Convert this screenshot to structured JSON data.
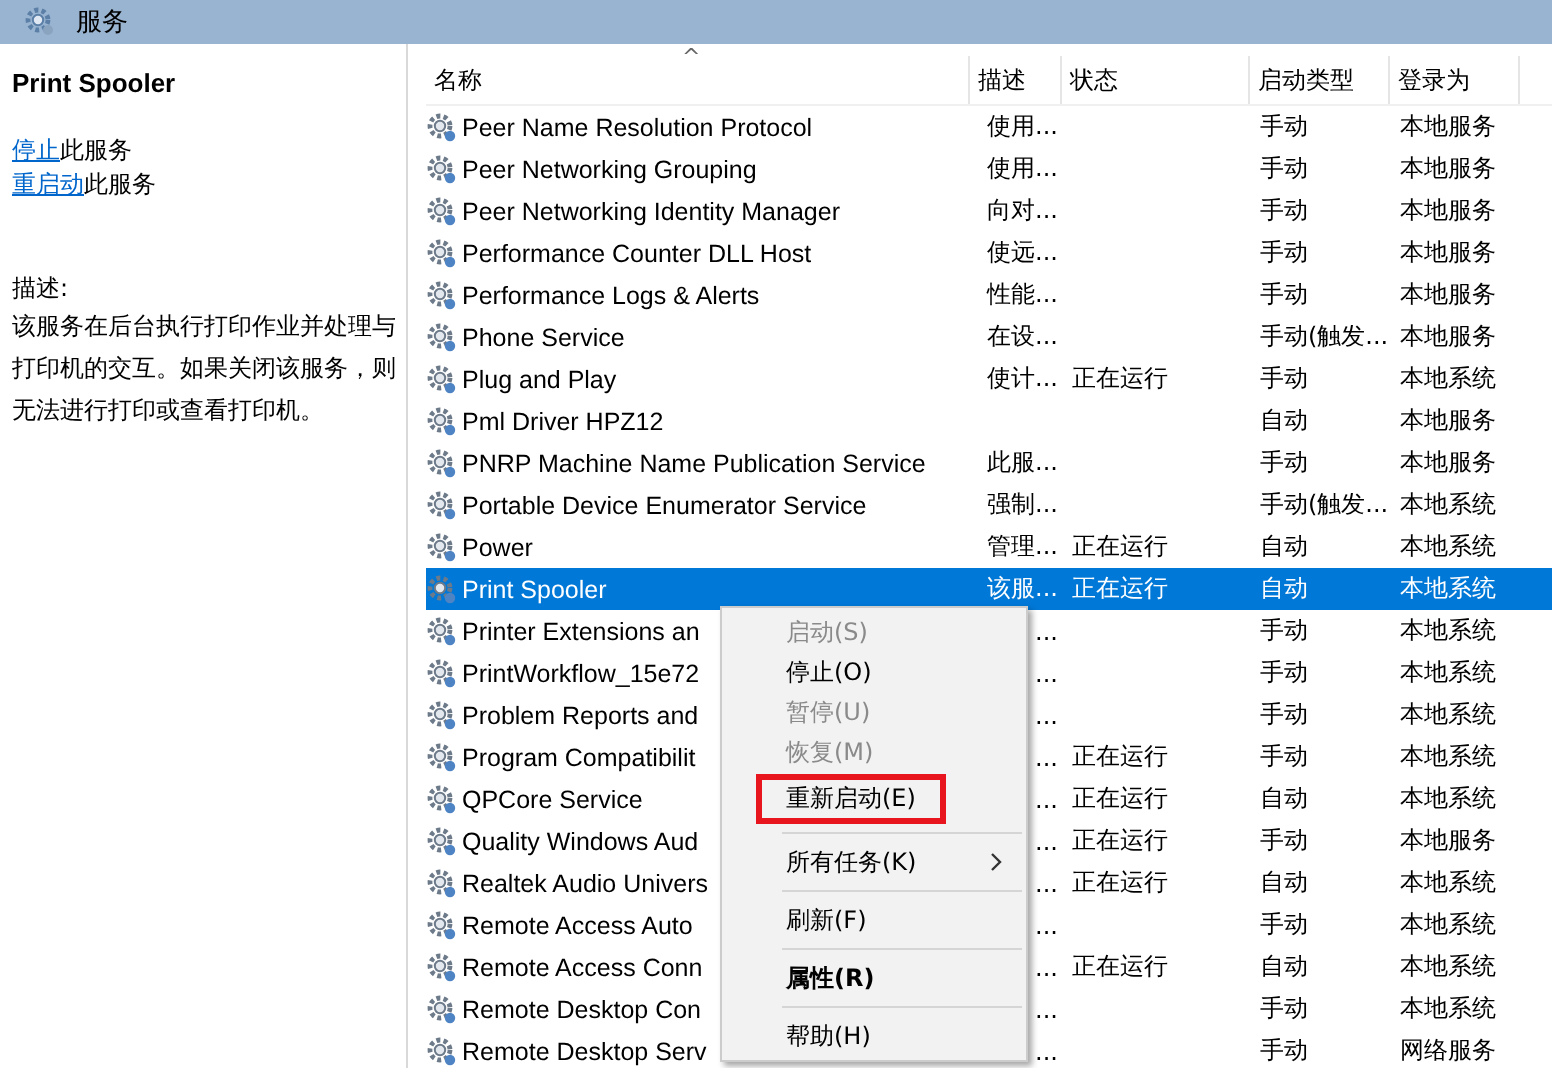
{
  "window": {
    "title": "服务"
  },
  "detail": {
    "service_name": "Print Spooler",
    "actions": [
      {
        "link": "停止",
        "rest": "此服务"
      },
      {
        "link": "重启动",
        "rest": "此服务"
      }
    ],
    "description_label": "描述:",
    "description": "该服务在后台执行打印作业并处理与打印机的交互。如果关闭该服务，则无法进行打印或查看打印机。"
  },
  "table": {
    "sort_indicator": "^",
    "columns": [
      "名称",
      "描述",
      "状态",
      "启动类型",
      "登录为"
    ],
    "rows": [
      {
        "name": "Peer Name Resolution Protocol",
        "description": "使用...",
        "status": "",
        "startup": "手动",
        "logon": "本地服务",
        "selected": false
      },
      {
        "name": "Peer Networking Grouping",
        "description": "使用...",
        "status": "",
        "startup": "手动",
        "logon": "本地服务",
        "selected": false
      },
      {
        "name": "Peer Networking Identity Manager",
        "description": "向对...",
        "status": "",
        "startup": "手动",
        "logon": "本地服务",
        "selected": false
      },
      {
        "name": "Performance Counter DLL Host",
        "description": "使远...",
        "status": "",
        "startup": "手动",
        "logon": "本地服务",
        "selected": false
      },
      {
        "name": "Performance Logs & Alerts",
        "description": "性能...",
        "status": "",
        "startup": "手动",
        "logon": "本地服务",
        "selected": false
      },
      {
        "name": "Phone Service",
        "description": "在设...",
        "status": "",
        "startup": "手动(触发...",
        "logon": "本地服务",
        "selected": false
      },
      {
        "name": "Plug and Play",
        "description": "使计...",
        "status": "正在运行",
        "startup": "手动",
        "logon": "本地系统",
        "selected": false
      },
      {
        "name": "Pml Driver HPZ12",
        "description": "",
        "status": "",
        "startup": "自动",
        "logon": "本地服务",
        "selected": false
      },
      {
        "name": "PNRP Machine Name Publication Service",
        "description": "此服...",
        "status": "",
        "startup": "手动",
        "logon": "本地服务",
        "selected": false
      },
      {
        "name": "Portable Device Enumerator Service",
        "description": "强制...",
        "status": "",
        "startup": "手动(触发...",
        "logon": "本地系统",
        "selected": false
      },
      {
        "name": "Power",
        "description": "管理...",
        "status": "正在运行",
        "startup": "自动",
        "logon": "本地系统",
        "selected": false
      },
      {
        "name": "Print Spooler",
        "description": "该服...",
        "status": "正在运行",
        "startup": "自动",
        "logon": "本地系统",
        "selected": true
      },
      {
        "name": "Printer Extensions an",
        "description": "...",
        "status": "",
        "startup": "手动",
        "logon": "本地系统",
        "selected": false
      },
      {
        "name": "PrintWorkflow_15e72",
        "description": "...",
        "status": "",
        "startup": "手动",
        "logon": "本地系统",
        "selected": false
      },
      {
        "name": "Problem Reports and",
        "description": "...",
        "status": "",
        "startup": "手动",
        "logon": "本地系统",
        "selected": false
      },
      {
        "name": "Program Compatibilit",
        "description": "...",
        "status": "正在运行",
        "startup": "手动",
        "logon": "本地系统",
        "selected": false
      },
      {
        "name": "QPCore Service",
        "description": "...",
        "status": "正在运行",
        "startup": "自动",
        "logon": "本地系统",
        "selected": false
      },
      {
        "name": "Quality Windows Aud",
        "description": "...",
        "status": "正在运行",
        "startup": "手动",
        "logon": "本地服务",
        "selected": false
      },
      {
        "name": "Realtek Audio Univers",
        "description": "...",
        "status": "正在运行",
        "startup": "自动",
        "logon": "本地系统",
        "selected": false
      },
      {
        "name": "Remote Access Auto",
        "description": "...",
        "status": "",
        "startup": "手动",
        "logon": "本地系统",
        "selected": false
      },
      {
        "name": "Remote Access Conn",
        "description": "...",
        "status": "正在运行",
        "startup": "自动",
        "logon": "本地系统",
        "selected": false
      },
      {
        "name": "Remote Desktop Con",
        "description": "...",
        "status": "",
        "startup": "手动",
        "logon": "本地系统",
        "selected": false
      },
      {
        "name": "Remote Desktop Serv",
        "description": "...",
        "status": "",
        "startup": "手动",
        "logon": "网络服务",
        "selected": false
      }
    ]
  },
  "context_menu": {
    "items": [
      {
        "kind": "item",
        "label": "启动(S)",
        "disabled": true,
        "highlighted": false,
        "bold": false,
        "submenu": false
      },
      {
        "kind": "item",
        "label": "停止(O)",
        "disabled": false,
        "highlighted": false,
        "bold": false,
        "submenu": false
      },
      {
        "kind": "item",
        "label": "暂停(U)",
        "disabled": true,
        "highlighted": false,
        "bold": false,
        "submenu": false
      },
      {
        "kind": "item",
        "label": "恢复(M)",
        "disabled": true,
        "highlighted": false,
        "bold": false,
        "submenu": false
      },
      {
        "kind": "item",
        "label": "重新启动(E)",
        "disabled": false,
        "highlighted": true,
        "bold": false,
        "submenu": false
      },
      {
        "kind": "separator"
      },
      {
        "kind": "item",
        "label": "所有任务(K)",
        "disabled": false,
        "highlighted": false,
        "bold": false,
        "submenu": true
      },
      {
        "kind": "separator"
      },
      {
        "kind": "item",
        "label": "刷新(F)",
        "disabled": false,
        "highlighted": false,
        "bold": false,
        "submenu": false
      },
      {
        "kind": "separator"
      },
      {
        "kind": "item",
        "label": "属性(R)",
        "disabled": false,
        "highlighted": false,
        "bold": true,
        "submenu": false
      },
      {
        "kind": "separator"
      },
      {
        "kind": "item",
        "label": "帮助(H)",
        "disabled": false,
        "highlighted": false,
        "bold": false,
        "submenu": false
      }
    ]
  }
}
